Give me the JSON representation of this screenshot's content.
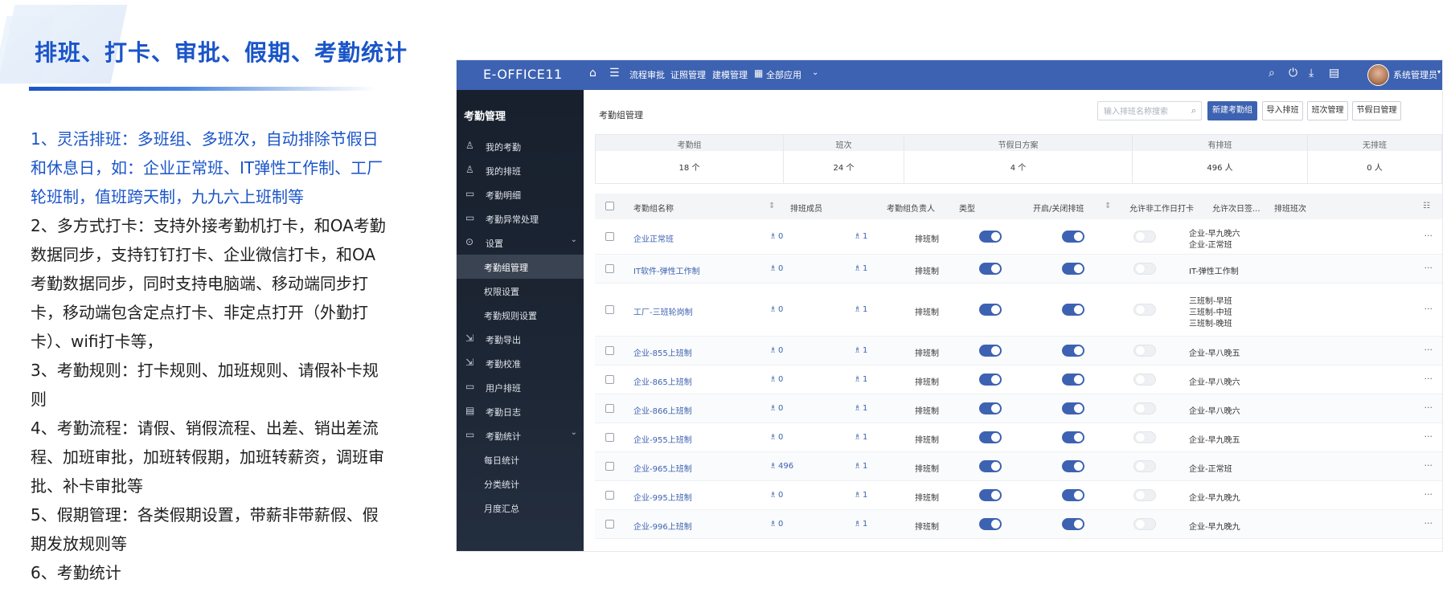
{
  "slide": {
    "title": "排班、打卡、审批、假期、考勤统计",
    "points": [
      {
        "text": "1、灵活排班：多班组、多班次，自动排除节假日和休息日，如：企业正常班、IT弹性工作制、工厂轮班制，值班跨天制，九九六上班制等",
        "highlight": true
      },
      {
        "text": "2、多方式打卡：支持外接考勤机打卡，和OA考勤数据同步，支持钉钉打卡、企业微信打卡，和OA考勤数据同步，同时支持电脑端、移动端同步打卡，移动端包含定点打卡、非定点打开（外勤打卡）、wifi打卡等，",
        "highlight": false
      },
      {
        "text": "3、考勤规则：打卡规则、加班规则、请假补卡规则",
        "highlight": false
      },
      {
        "text": "4、考勤流程：请假、销假流程、出差、销出差流程、加班审批，加班转假期，加班转薪资，调班审批、补卡审批等",
        "highlight": false
      },
      {
        "text": "5、假期管理：各类假期设置，带薪非带薪假、假期发放规则等",
        "highlight": false
      },
      {
        "text": "6、考勤统计",
        "highlight": false
      }
    ]
  },
  "app": {
    "brand": "E-OFFICE11",
    "nav_links": [
      "流程审批",
      "证照管理",
      "建模管理",
      "全部应用"
    ],
    "user_name": "系统管理员",
    "sidebar": {
      "title": "考勤管理",
      "items": [
        {
          "label": "我的考勤",
          "icon": "user-clock-icon"
        },
        {
          "label": "我的排班",
          "icon": "user-schedule-icon"
        },
        {
          "label": "考勤明细",
          "icon": "detail-icon"
        },
        {
          "label": "考勤异常处理",
          "icon": "exception-icon"
        },
        {
          "label": "设置",
          "icon": "gear-icon"
        },
        {
          "label": "考勤组管理",
          "sub": true,
          "active": true
        },
        {
          "label": "权限设置",
          "sub": true
        },
        {
          "label": "考勤规则设置",
          "sub": true
        },
        {
          "label": "考勤导出",
          "icon": "export-icon"
        },
        {
          "label": "考勤校准",
          "icon": "calibrate-icon"
        },
        {
          "label": "用户排班",
          "icon": "user-shift-icon"
        },
        {
          "label": "考勤日志",
          "icon": "log-icon"
        },
        {
          "label": "考勤统计",
          "icon": "stats-icon"
        },
        {
          "label": "每日统计",
          "sub": true
        },
        {
          "label": "分类统计",
          "sub": true
        },
        {
          "label": "月度汇总",
          "sub": true
        }
      ]
    },
    "main": {
      "breadcrumb": "考勤组管理",
      "search_placeholder": "输入排班名称搜索",
      "buttons": [
        "新建考勤组",
        "导入排班",
        "班次管理",
        "节假日管理"
      ],
      "stats": [
        {
          "label": "考勤组",
          "value": "18 个"
        },
        {
          "label": "班次",
          "value": "24 个"
        },
        {
          "label": "节假日方案",
          "value": "4 个"
        },
        {
          "label": "有排班",
          "value": "496 人"
        },
        {
          "label": "无排班",
          "value": "0 人"
        }
      ],
      "columns": [
        "考勤组名称",
        "排班成员",
        "考勤组负责人",
        "类型",
        "开启/关闭排班",
        "允许非工作日打卡",
        "允许次日签...",
        "排班班次"
      ],
      "rows": [
        {
          "name": "企业正常班",
          "members": "0",
          "owners": "1",
          "type": "排班制",
          "schedule_on": true,
          "nonwork_on": true,
          "nextday_on": false,
          "shifts": [
            "企业-早九晚六",
            "企业-正常班"
          ]
        },
        {
          "name": "IT软件-弹性工作制",
          "members": "0",
          "owners": "1",
          "type": "排班制",
          "schedule_on": true,
          "nonwork_on": true,
          "nextday_on": false,
          "shifts": [
            "IT-弹性工作制"
          ]
        },
        {
          "name": "工厂-三班轮岗制",
          "members": "0",
          "owners": "1",
          "type": "排班制",
          "schedule_on": true,
          "nonwork_on": true,
          "nextday_on": false,
          "shifts": [
            "三班制-早班",
            "三班制-中班",
            "三班制-晚班"
          ]
        },
        {
          "name": "企业-855上班制",
          "members": "0",
          "owners": "1",
          "type": "排班制",
          "schedule_on": true,
          "nonwork_on": true,
          "nextday_on": false,
          "shifts": [
            "企业-早八晚五"
          ]
        },
        {
          "name": "企业-865上班制",
          "members": "0",
          "owners": "1",
          "type": "排班制",
          "schedule_on": true,
          "nonwork_on": true,
          "nextday_on": false,
          "shifts": [
            "企业-早八晚六"
          ]
        },
        {
          "name": "企业-866上班制",
          "members": "0",
          "owners": "1",
          "type": "排班制",
          "schedule_on": true,
          "nonwork_on": true,
          "nextday_on": false,
          "shifts": [
            "企业-早八晚六"
          ]
        },
        {
          "name": "企业-955上班制",
          "members": "0",
          "owners": "1",
          "type": "排班制",
          "schedule_on": true,
          "nonwork_on": true,
          "nextday_on": false,
          "shifts": [
            "企业-早九晚五"
          ]
        },
        {
          "name": "企业-965上班制",
          "members": "496",
          "owners": "1",
          "type": "排班制",
          "schedule_on": true,
          "nonwork_on": true,
          "nextday_on": false,
          "shifts": [
            "企业-正常班"
          ]
        },
        {
          "name": "企业-995上班制",
          "members": "0",
          "owners": "1",
          "type": "排班制",
          "schedule_on": true,
          "nonwork_on": true,
          "nextday_on": false,
          "shifts": [
            "企业-早九晚九"
          ]
        },
        {
          "name": "企业-996上班制",
          "members": "0",
          "owners": "1",
          "type": "排班制",
          "schedule_on": true,
          "nonwork_on": true,
          "nextday_on": false,
          "shifts": [
            "企业-早九晚九"
          ]
        }
      ]
    },
    "colors": {
      "accent": "#3d62b1",
      "title_blue": "#1a55c8",
      "sidebar_bg": "#1d2634"
    }
  }
}
